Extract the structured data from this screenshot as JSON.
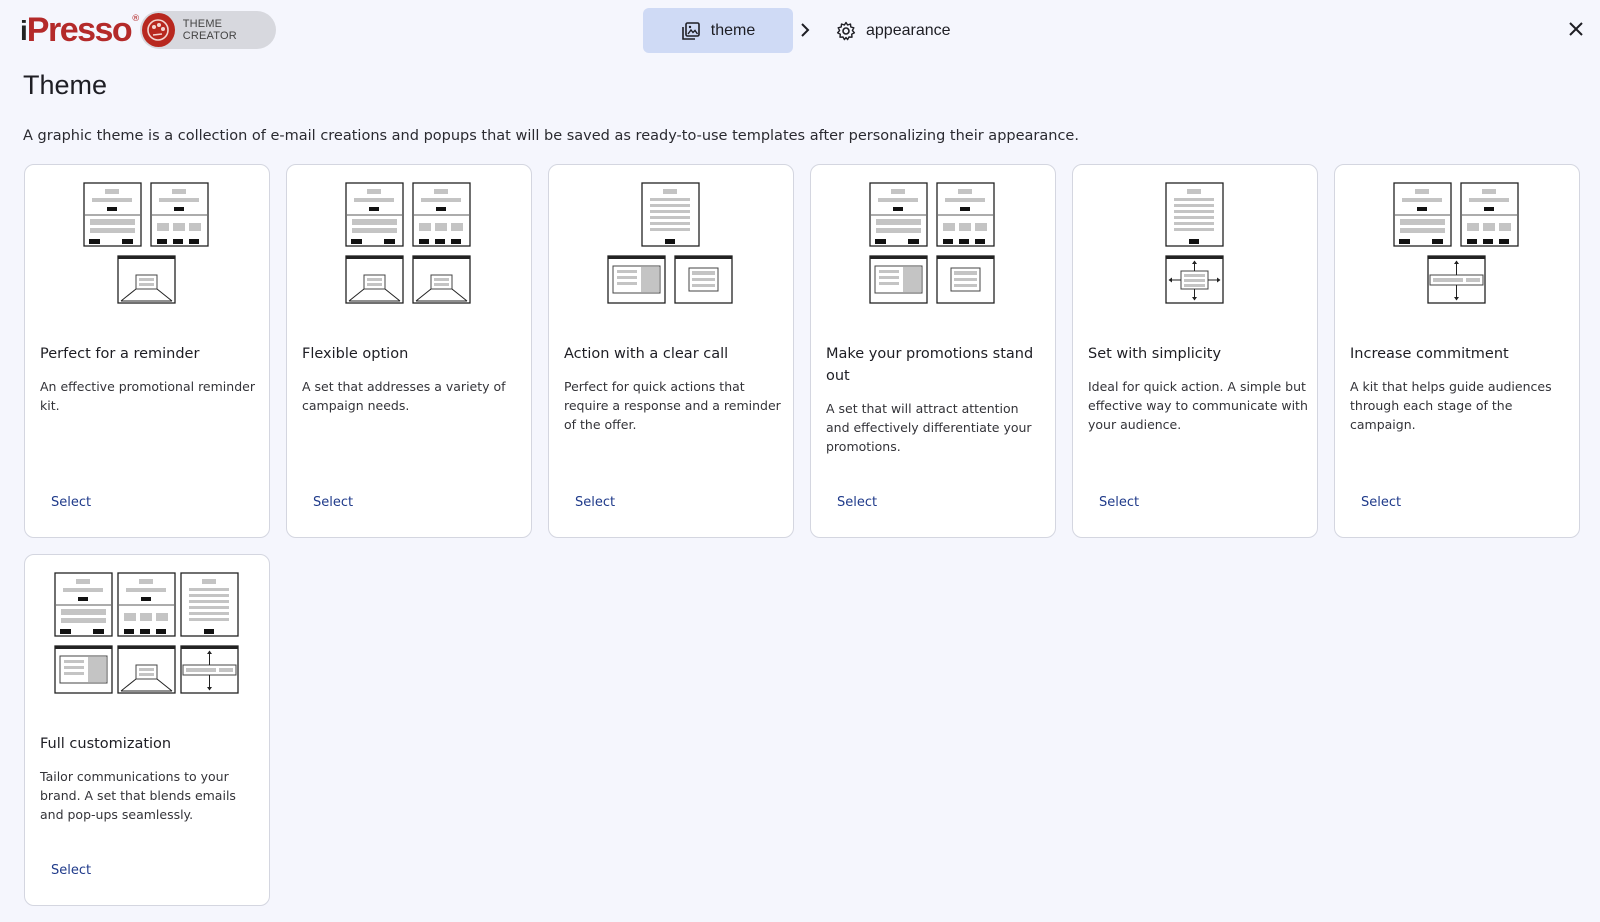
{
  "header": {
    "logo_prefix": "i",
    "logo_text": "Presso",
    "logo_mark": "®",
    "badge_label": "THEME CREATOR",
    "steps": [
      {
        "label": "theme",
        "icon": "image-gallery-icon",
        "active": true
      },
      {
        "label": "appearance",
        "icon": "gear-icon",
        "active": false
      }
    ],
    "close_icon": "close-icon"
  },
  "page": {
    "title": "Theme",
    "description": "A graphic theme is a collection of e-mail creations and popups that will be saved as ready-to-use templates after personalizing their appearance."
  },
  "cards": [
    {
      "title": "Perfect for a reminder",
      "description": "An effective promotional reminder kit.",
      "select_label": "Select"
    },
    {
      "title": "Flexible option",
      "description": "A set that addresses a variety of campaign needs.",
      "select_label": "Select"
    },
    {
      "title": "Action with a clear call",
      "description": "Perfect for quick actions that require a response and a reminder of the offer.",
      "select_label": "Select"
    },
    {
      "title": "Make your promotions stand out",
      "description": "A set that will attract attention and effectively differentiate your promotions.",
      "select_label": "Select"
    },
    {
      "title": "Set with simplicity",
      "description": "Ideal for quick action. A simple but effective way to communicate with your audience.",
      "select_label": "Select"
    },
    {
      "title": "Increase commitment",
      "description": "A kit that helps guide audiences through each stage of the campaign.",
      "select_label": "Select"
    },
    {
      "title": "Full customization",
      "description": "Tailor communications to your brand. A set that blends emails and pop-ups seamlessly.",
      "select_label": "Select"
    }
  ],
  "colors": {
    "background": "#f5f6fd",
    "brand_red": "#b42a2a",
    "active_step": "#cfdaf5",
    "link": "#1f3a8a"
  }
}
